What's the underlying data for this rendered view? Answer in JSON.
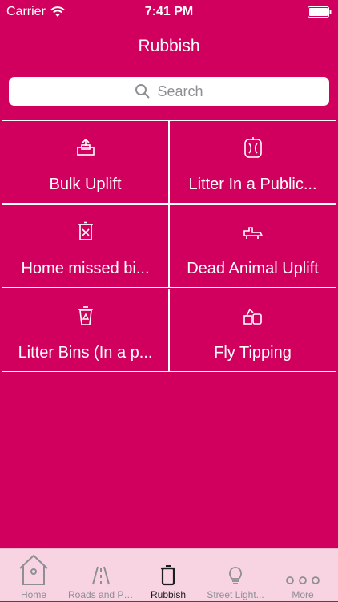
{
  "status_bar": {
    "carrier": "Carrier",
    "time": "7:41 PM"
  },
  "nav": {
    "title": "Rubbish"
  },
  "search": {
    "placeholder": "Search"
  },
  "tiles": [
    {
      "label": "Bulk Uplift",
      "icon": "box-upload-icon"
    },
    {
      "label": "Litter In a Public...",
      "icon": "apple-core-icon"
    },
    {
      "label": "Home missed bi...",
      "icon": "missed-bin-icon"
    },
    {
      "label": "Dead Animal Uplift",
      "icon": "dead-animal-icon"
    },
    {
      "label": "Litter Bins (In a p...",
      "icon": "recycling-bin-icon"
    },
    {
      "label": "Fly Tipping",
      "icon": "dumped-items-icon"
    }
  ],
  "tabs": [
    {
      "label": "Home",
      "icon": "house-icon",
      "active": false
    },
    {
      "label": "Roads and Pa...",
      "icon": "road-icon",
      "active": false
    },
    {
      "label": "Rubbish",
      "icon": "bin-icon",
      "active": true
    },
    {
      "label": "Street Light...",
      "icon": "lightbulb-icon",
      "active": false
    },
    {
      "label": "More",
      "icon": "more-dots-icon",
      "active": false
    }
  ],
  "colors": {
    "background": "#d1005e",
    "tab_bar": "#f8d4e2",
    "tab_inactive": "#8e8e93",
    "tab_active": "#1d1d1d"
  }
}
